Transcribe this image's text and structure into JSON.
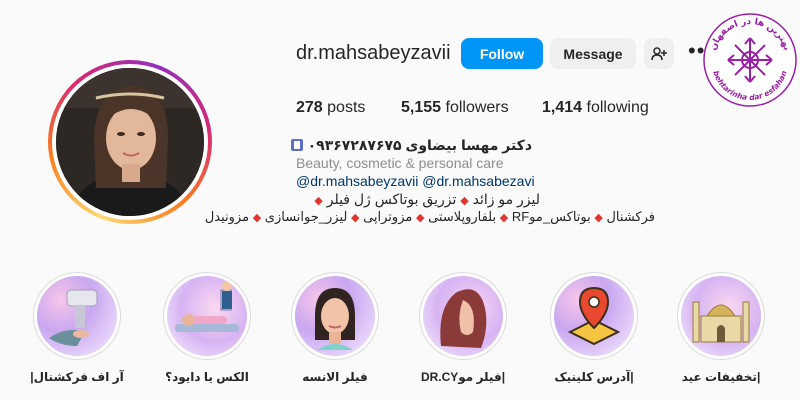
{
  "profile": {
    "username": "dr.mahsabeyzavii",
    "follow_label": "Follow",
    "message_label": "Message",
    "more_label": "•••",
    "stats": {
      "posts_count": "278",
      "posts_label": "posts",
      "followers_count": "5,155",
      "followers_label": "followers",
      "following_count": "1,414",
      "following_label": "following"
    },
    "bio": {
      "name_line": "دکتر مهسا بیضاوی ۰۹۳۶۷۲۸۷۶۷۵",
      "category": "Beauty, cosmetic & personal care",
      "link1": "@dr.mahsabeyzavii",
      "link2": "@dr.mahsabezavi",
      "line1_a": "لیزر مو زائد",
      "line1_b": "تزریق بوتاکس ژل فیلر",
      "line2_a": "فرکشنال",
      "line2_b": "بوتاکس_موRF",
      "line2_c": "بلفاروپلاستی",
      "line2_d": "مزوتراپی",
      "line2_e": "لیزر_جوانسازی",
      "line2_f": "مزونیدل"
    }
  },
  "logo": {
    "text_top": "بهترین ها در اصفهان",
    "text_bottom": "behtarinha dar esfahan"
  },
  "highlights": [
    {
      "label": "آر اف فرکشنال|"
    },
    {
      "label": "الکس یا دایود؟"
    },
    {
      "label": "فیلر الانسه"
    },
    {
      "label": "|فیلر موDR.CY"
    },
    {
      "label": "|آدرس کلینیک"
    },
    {
      "label": "|تخفیفات عید"
    }
  ],
  "colors": {
    "follow_button": "#0095f6",
    "link": "#00376b",
    "logo": "#9b1fa6"
  }
}
